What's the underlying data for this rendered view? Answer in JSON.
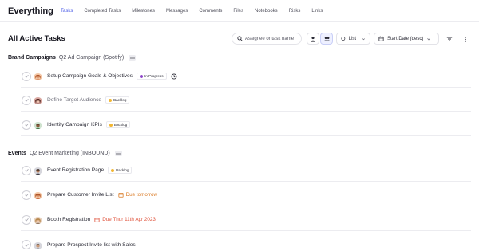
{
  "app": {
    "title": "Everything"
  },
  "tabs": [
    "Tasks",
    "Completed Tasks",
    "Milestones",
    "Messages",
    "Comments",
    "Files",
    "Notebooks",
    "Risks",
    "Links"
  ],
  "toolbar": {
    "page_title": "All Active Tasks",
    "search_placeholder": "Assignee or task name",
    "view_label": "List",
    "sort_label": "Start Date (desc)"
  },
  "colors": {
    "accent": "#3f51e6",
    "in_progress": "#8e44c9",
    "backlog": "#f2b632",
    "due_soon": "#d9771f",
    "overdue": "#e0533c"
  },
  "groups": [
    {
      "name": "Brand Campaigns",
      "project": "Q2 Ad Campaign (Spotify)",
      "tasks": [
        {
          "name": "Setup Campaign Goals & Objectives",
          "status": "In Progress",
          "status_color": "#8e44c9"
        },
        {
          "name": "Define Target Audience",
          "status": "Backlog",
          "status_color": "#f2b632"
        },
        {
          "name": "Identify Campaign KPIs",
          "status": "Backlog",
          "status_color": "#f2b632"
        }
      ]
    },
    {
      "name": "Events",
      "project": "Q2 Event Marketing (INBOUND)",
      "tasks": [
        {
          "name": "Event Registration Page",
          "status": "Backlog",
          "status_color": "#f2b632"
        },
        {
          "name": "Prepare Customer Invite List",
          "due": "Due tomorrow",
          "due_color": "#d9771f"
        },
        {
          "name": "Booth Registration",
          "due": "Due Thur 11th Apr 2023",
          "due_color": "#e0533c"
        },
        {
          "name": "Prepare Prospect Invite list with Sales"
        }
      ]
    }
  ]
}
